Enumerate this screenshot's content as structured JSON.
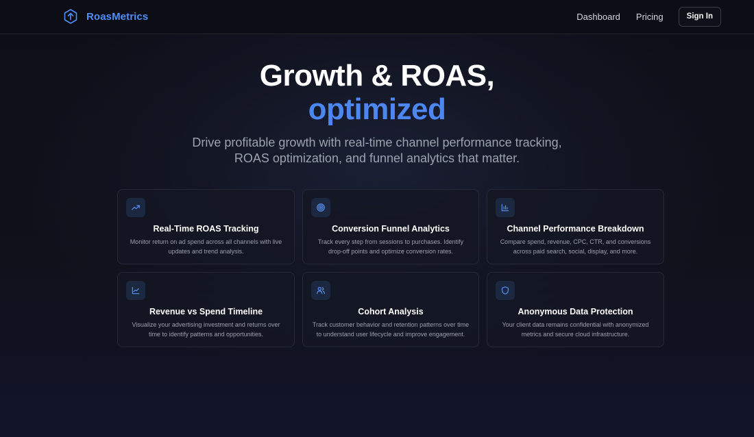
{
  "nav": {
    "brand": "RoasMetrics",
    "links": [
      "Dashboard",
      "Pricing"
    ],
    "signin_label": "Sign In"
  },
  "hero": {
    "title_line1": "Growth & ROAS,",
    "title_line2": "optimized",
    "subtitle_line1": "Drive profitable growth with real-time channel performance tracking,",
    "subtitle_line2": "ROAS optimization, and funnel analytics that matter."
  },
  "features": [
    {
      "icon": "trending-up-icon",
      "title": "Real-Time ROAS Tracking",
      "description": "Monitor return on ad spend across all channels with live updates and trend analysis."
    },
    {
      "icon": "target-icon",
      "title": "Conversion Funnel Analytics",
      "description": "Track every step from sessions to purchases. Identify drop-off points and optimize conversion rates."
    },
    {
      "icon": "bar-chart-icon",
      "title": "Channel Performance Breakdown",
      "description": "Compare spend, revenue, CPC, CTR, and conversions across paid search, social, display, and more."
    },
    {
      "icon": "line-chart-icon",
      "title": "Revenue vs Spend Timeline",
      "description": "Visualize your advertising investment and returns over time to identify patterns and opportunities."
    },
    {
      "icon": "users-icon",
      "title": "Cohort Analysis",
      "description": "Track customer behavior and retention patterns over time to understand user lifecycle and improve engagement."
    },
    {
      "icon": "shield-icon",
      "title": "Anonymous Data Protection",
      "description": "Your client data remains confidential with anonymized metrics and secure cloud infrastructure."
    }
  ],
  "colors": {
    "accent": "#4c86ef",
    "background": "#0d0e17",
    "card_background": "#141623",
    "icon_tile": "#1c2740"
  }
}
